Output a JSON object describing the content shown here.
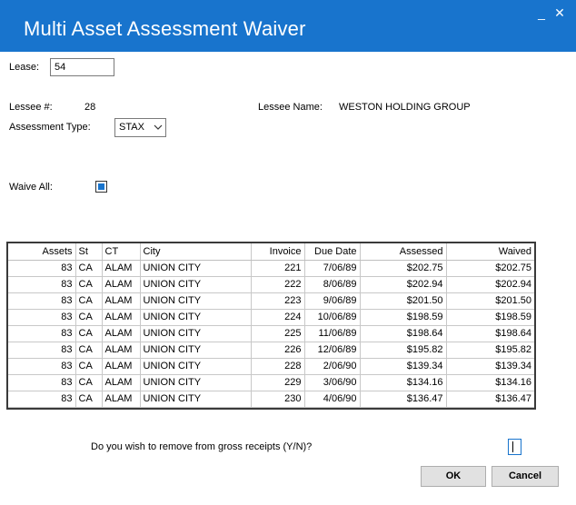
{
  "window": {
    "title": "Multi Asset Assessment Waiver",
    "minimize": "_",
    "close": "✕"
  },
  "form": {
    "lease_label": "Lease:",
    "lease_value": "54",
    "lessee_num_label": "Lessee #:",
    "lessee_num_value": "28",
    "lessee_name_label": "Lessee Name:",
    "lessee_name_value": "WESTON HOLDING GROUP",
    "assessment_type_label": "Assessment Type:",
    "assessment_type_value": "STAX",
    "waive_all_label": "Waive All:",
    "waive_all_checked": true
  },
  "table": {
    "columns": [
      "Assets",
      "St",
      "CT",
      "City",
      "Invoice",
      "Due Date",
      "Assessed",
      "Waived"
    ],
    "rows": [
      [
        "83",
        "CA",
        "ALAM",
        "UNION CITY",
        "221",
        "7/06/89",
        "$202.75",
        "$202.75"
      ],
      [
        "83",
        "CA",
        "ALAM",
        "UNION CITY",
        "222",
        "8/06/89",
        "$202.94",
        "$202.94"
      ],
      [
        "83",
        "CA",
        "ALAM",
        "UNION CITY",
        "223",
        "9/06/89",
        "$201.50",
        "$201.50"
      ],
      [
        "83",
        "CA",
        "ALAM",
        "UNION CITY",
        "224",
        "10/06/89",
        "$198.59",
        "$198.59"
      ],
      [
        "83",
        "CA",
        "ALAM",
        "UNION CITY",
        "225",
        "11/06/89",
        "$198.64",
        "$198.64"
      ],
      [
        "83",
        "CA",
        "ALAM",
        "UNION CITY",
        "226",
        "12/06/89",
        "$195.82",
        "$195.82"
      ],
      [
        "83",
        "CA",
        "ALAM",
        "UNION CITY",
        "228",
        "2/06/90",
        "$139.34",
        "$139.34"
      ],
      [
        "83",
        "CA",
        "ALAM",
        "UNION CITY",
        "229",
        "3/06/90",
        "$134.16",
        "$134.16"
      ],
      [
        "83",
        "CA",
        "ALAM",
        "UNION CITY",
        "230",
        "4/06/90",
        "$136.47",
        "$136.47"
      ]
    ]
  },
  "prompt": {
    "text": "Do you wish to remove from gross receipts (Y/N)?",
    "answer": ""
  },
  "buttons": {
    "ok": "OK",
    "cancel": "Cancel"
  },
  "colors": {
    "titlebar": "#1874cd",
    "checkbox_fill": "#1874cd"
  }
}
